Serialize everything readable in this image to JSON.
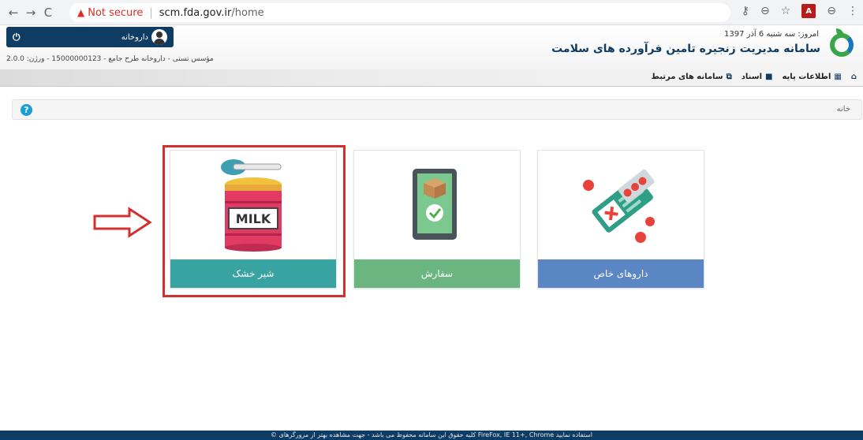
{
  "browser": {
    "back_icon": "←",
    "forward_icon": "→",
    "reload_icon": "C",
    "warning_icon": "▲",
    "not_secure": "Not secure",
    "separator": "|",
    "url_host": "scm.fda.gov.ir",
    "url_path": "/home",
    "key_icon": "⚷",
    "zoom_icon": "⊖",
    "star_icon": "☆",
    "pdf_icon_text": "A",
    "profile_icon": "⊖",
    "menu_icon": "⋮"
  },
  "header": {
    "power_icon": "⏻",
    "user_name": "داروخانه",
    "org_info": "مؤسس تستی - داروخانه طرح جامع - 15000000123 - ورژن: 2.0.0",
    "date_text": "امروز: سه شنبه 6 آذر 1397",
    "site_title": "سامانه مدیریت زنجیره تامین فرآورده های سلامت"
  },
  "nav": {
    "home_icon": "⌂",
    "items": [
      {
        "icon": "▦",
        "label": "اطلاعات پایه"
      },
      {
        "icon": "■",
        "label": "اسناد"
      },
      {
        "icon": "⧉",
        "label": "سامانه های مرتبط"
      }
    ]
  },
  "breadcrumb": {
    "help_icon": "?",
    "home": "خانه"
  },
  "cards": [
    {
      "label": "شیر خشک",
      "milk_text": "MILK"
    },
    {
      "label": "سفارش"
    },
    {
      "label": "داروهای خاص"
    }
  ],
  "footer": {
    "text": "© کلیه حقوق این سامانه محفوظ می باشد - جهت مشاهده بهتر از مرورگرهای FireFox, IE 11+, Chrome استفاده نمایید"
  },
  "colors": {
    "header_dark": "#0f3c63",
    "milk_label": "#38a3a0",
    "order_label": "#6bb581",
    "drugs_label": "#5b86c4",
    "highlight": "#d32f2f"
  }
}
